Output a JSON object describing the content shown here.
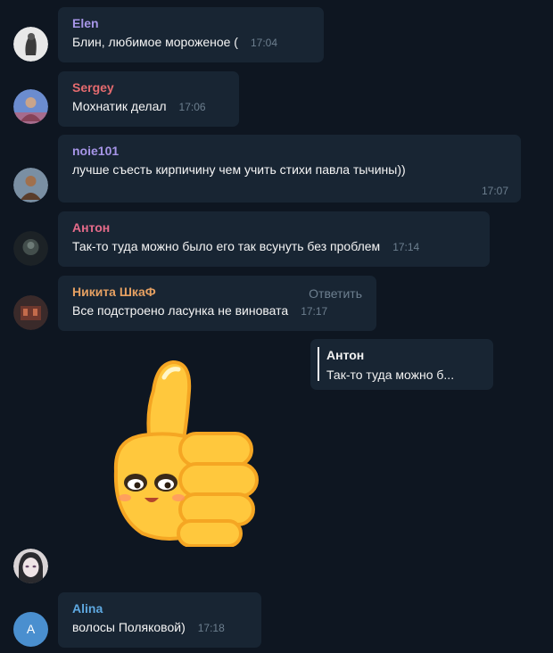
{
  "messages": [
    {
      "author": "Elen",
      "author_color": "#a695e7",
      "text": "Блин, любимое мороженое (",
      "time": "17:04"
    },
    {
      "author": "Sergey",
      "author_color": "#e56b6f",
      "text": "Мохнатик делал",
      "time": "17:06"
    },
    {
      "author": "noie101",
      "author_color": "#a695e7",
      "text": "лучше съесть кирпичину чем учить стихи павла тычины))",
      "time": "17:07"
    },
    {
      "author": "Антон",
      "author_color": "#e56b8a",
      "text": "Так-то туда можно было его так всунуть без проблем",
      "time": "17:14"
    },
    {
      "author": "Никита ШкаФ",
      "author_color": "#e5a062",
      "text": "Все подстроено ласунка не виновата",
      "time": "17:17",
      "reply_label": "Ответить"
    },
    {
      "author": "Alina",
      "author_color": "#5ea8e0",
      "text": "волосы Поляковой)",
      "time": "17:18"
    }
  ],
  "reply_preview": {
    "author": "Антон",
    "text": "Так-то туда можно б..."
  },
  "alina_avatar_letter": "A",
  "sticker": {
    "icon": "thumbs-up-sticker-icon"
  }
}
